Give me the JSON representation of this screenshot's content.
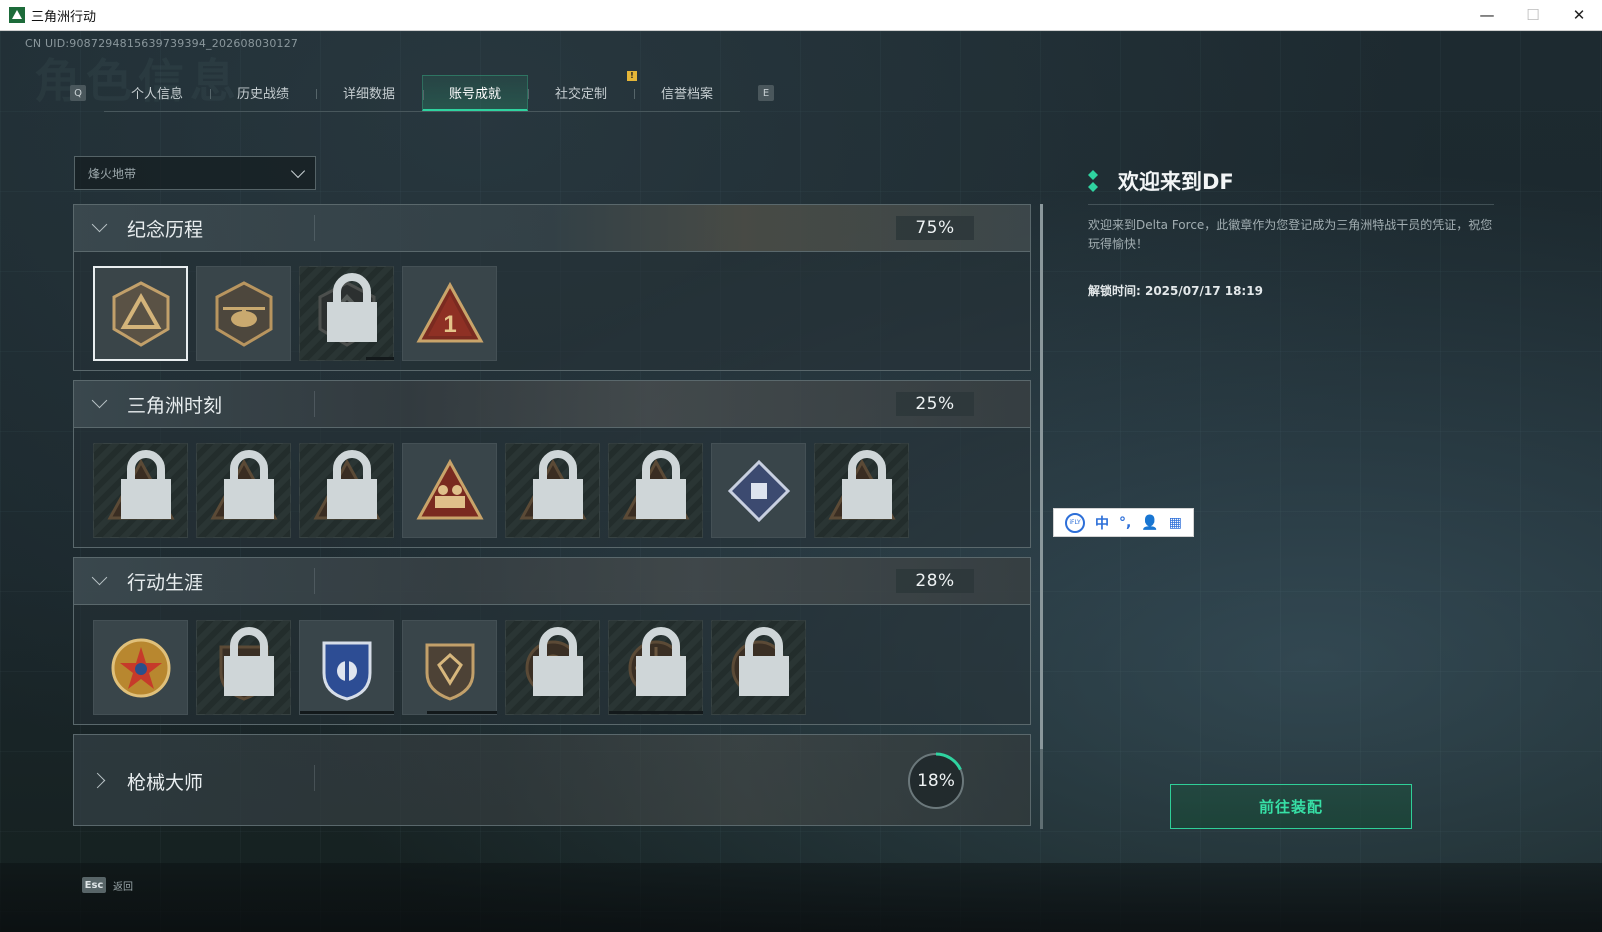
{
  "window": {
    "title": "三角洲行动",
    "minimize": "—",
    "maximize": "☐",
    "close": "✕"
  },
  "header": {
    "uid": "CN UID:9087294815639739394_202608030127",
    "watermark": "角色信息"
  },
  "tabs": {
    "prev_key": "Q",
    "next_key": "E",
    "items": [
      {
        "label": "个人信息"
      },
      {
        "label": "历史战绩"
      },
      {
        "label": "详细数据"
      },
      {
        "label": "账号成就",
        "active": true
      },
      {
        "label": "社交定制",
        "alert": "!"
      },
      {
        "label": "信誉档案"
      }
    ]
  },
  "filter": {
    "selected": "烽火地带"
  },
  "categories": [
    {
      "title": "纪念历程",
      "code": "001",
      "progress": "75%",
      "expanded": true
    },
    {
      "title": "三角洲时刻",
      "code": "002",
      "progress": "25%",
      "expanded": true
    },
    {
      "title": "行动生涯",
      "code": "003",
      "progress": "28%",
      "expanded": true
    },
    {
      "title": "枪械大师",
      "code": "004",
      "progress": "18%",
      "progress_value": 0.18,
      "expanded": false
    }
  ],
  "detail": {
    "title": "欢迎来到DF",
    "description": "欢迎来到Delta Force，此徽章作为您登记成为三角洲特战干员的凭证，祝您玩得愉快！",
    "unlock_time": "解锁时间: 2025/07/17 18:19"
  },
  "cta": {
    "label": "前往装配"
  },
  "ime": {
    "logo": "iFLY",
    "mode": "中",
    "punct": "°,",
    "user": "👤",
    "apps": "▦"
  },
  "footer": {
    "esc_key": "Esc",
    "esc_label": "返回"
  },
  "colors": {
    "accent": "#2fd3a0",
    "badge_gold": "#c2a06a",
    "badge_red": "#8a2a22",
    "alert": "#e5b638"
  }
}
